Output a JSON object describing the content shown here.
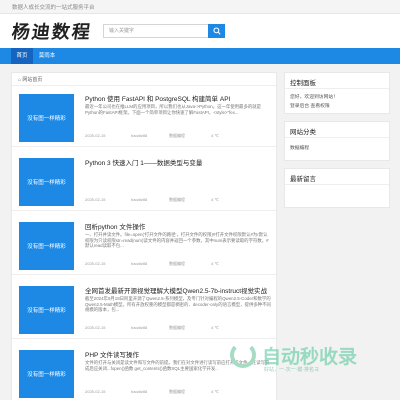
{
  "topbar": {
    "tagline": "数据人成长交流的一站式服务平台"
  },
  "header": {
    "logo_text": "杨迪数程",
    "search_placeholder": "输入关键字"
  },
  "nav": {
    "items": [
      "首页",
      "莫雨本"
    ]
  },
  "breadcrumb": "网站首页",
  "posts": [
    {
      "thumb": "没有图一样精彩",
      "title": "Python 使用 FastAPI 和 PostgreSQL 构建简单 API",
      "excerpt": "最近一年公司也在推LLM的应用项目，所以我们也从Java->Python。这一年使用最多的就是Python的FastAPI框架。下面一个简单项目让你快速了解FastAPI，<style>\"fex...",
      "date": "2025-02-15",
      "author": "haodiz88",
      "category": "数据编程",
      "views": "4 ℃"
    },
    {
      "thumb": "没有图一样精彩",
      "title": "Python 3 快速入门 1——数据类型与变量",
      "excerpt": "",
      "date": "2025-02-15",
      "author": "haodiz88",
      "category": "数据编程",
      "views": "4 ℃"
    },
    {
      "thumb": "没有图一样精彩",
      "title": "回析python 文件操作",
      "excerpt": "一、打开并读文件。file=open('打开文件的路径'，打开文件的权限)#打开文件权限默认#为r默认权限为只读权限str=read(num)读文件的内容并返回一个参数，其中num表示要读取的字符数，#默认read读取不包...",
      "date": "2025-02-15",
      "author": "haodiz88",
      "category": "数据编程",
      "views": "4 ℃"
    },
    {
      "thumb": "没有图一样精彩",
      "title": "全网首发最新开源视觉理解大模型Qwen2.5-7b-instruct视觉实战",
      "excerpt": "截至2024年9月18日阿里开源了Qwen2.5-系列模型，及专门针对编程的Qwen2.5-Coder和数学的Qwen2.5-Math模型。所有开放权重的模型都是稠密的、decoder-only的语言模型，提供多种不同规模的版本，包...",
      "date": "2025-02-15",
      "author": "haodiz88",
      "category": "数据编程",
      "views": "4 ℃"
    },
    {
      "thumb": "没有图一样精彩",
      "title": "PHP 文件读写操作",
      "excerpt": "文件的打开与关闭是读文件和写文件的前提。我们在对文件进行读写前应打开该文件，在读写完成后应关闭...fopen()函数 get_contents()函数SQL主要国家化学开发..",
      "date": "2025-02-15",
      "author": "haodiz88",
      "category": "数据编程",
      "views": "4 ℃"
    }
  ],
  "sidebar": {
    "panel": {
      "title": "控制面板",
      "greeting": "您好，欢迎到访网站！",
      "links": "登录后台  查看权限"
    },
    "categories": {
      "title": "网站分类",
      "items": [
        "数据编程"
      ]
    },
    "comments": {
      "title": "最新留言"
    }
  },
  "watermark": {
    "text": "自动秒收录",
    "sub": "好站，一·次一·键·排名ヨ"
  },
  "colors": {
    "accent": "#1e88e5",
    "accent_dark": "#1565c0"
  }
}
